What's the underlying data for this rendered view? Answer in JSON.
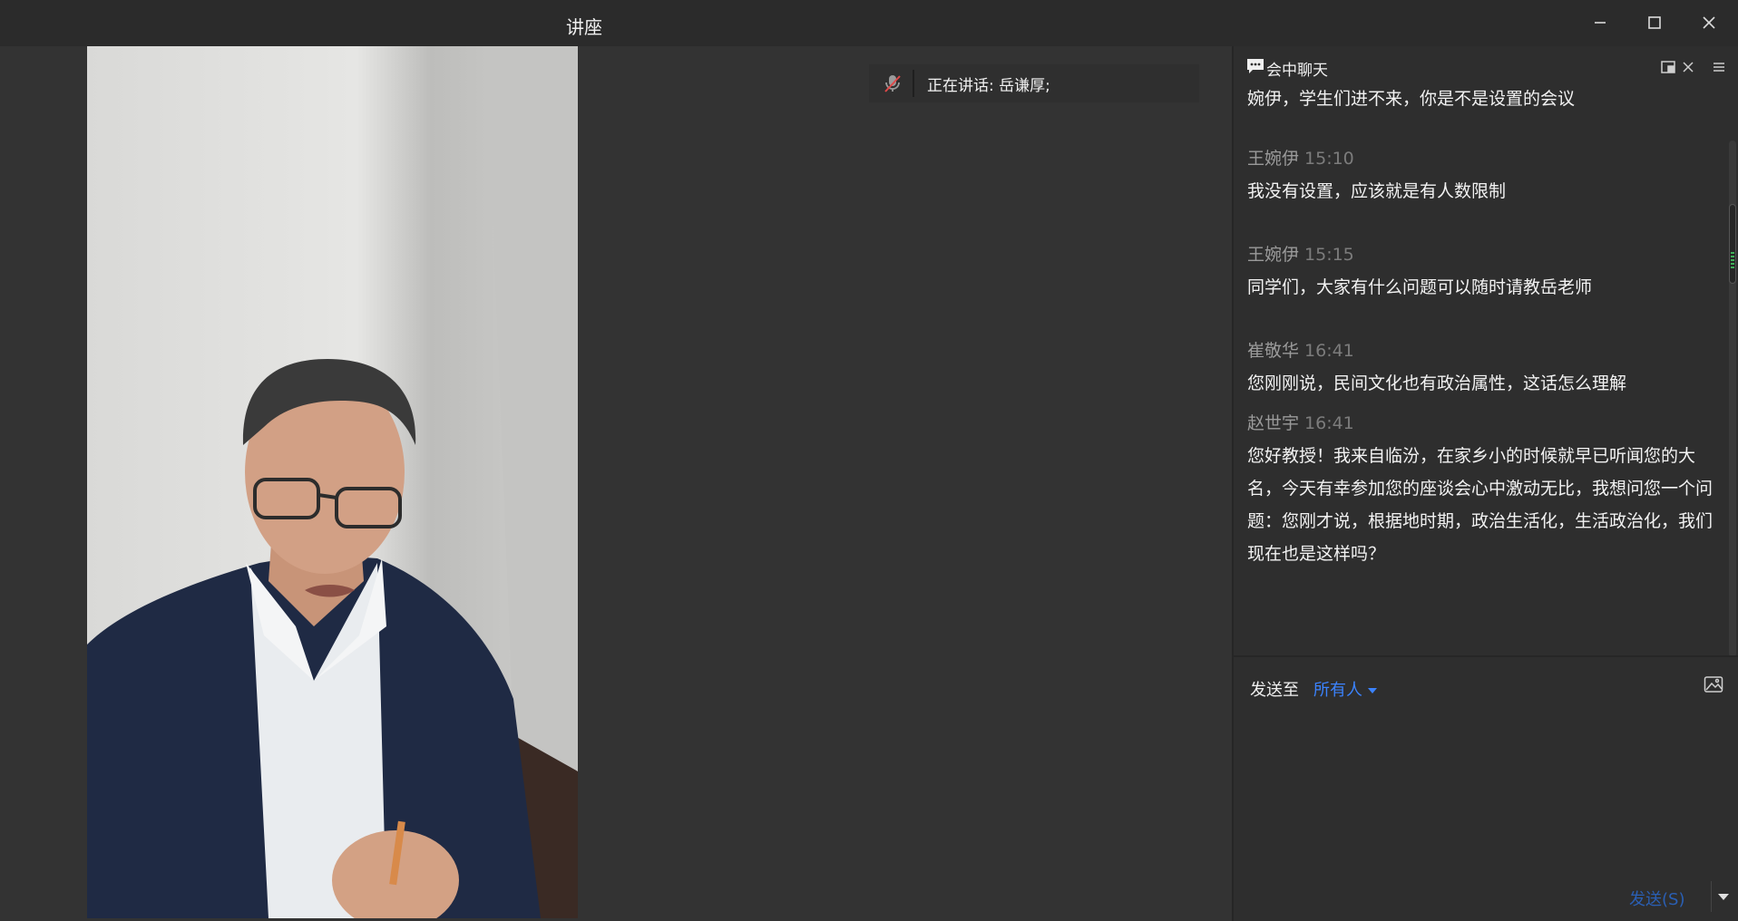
{
  "window": {
    "title": "讲座"
  },
  "speaking": {
    "label": "正在讲话: 岳谦厚;"
  },
  "chat": {
    "title": "会中聊天",
    "messages": [
      {
        "sender": "",
        "time": "",
        "text": "婉伊，学生们进不来，你是不是设置的会议"
      },
      {
        "sender": "王婉伊",
        "time": "15:10",
        "text": "我没有设置，应该就是有人数限制"
      },
      {
        "sender": "王婉伊",
        "time": "15:15",
        "text": "同学们，大家有什么问题可以随时请教岳老师"
      },
      {
        "sender": "崔敬华",
        "time": "16:41",
        "text": "您刚刚说，民间文化也有政治属性，这话怎么理解"
      },
      {
        "sender": "赵世宇",
        "time": "16:41",
        "text": "您好教授！我来自临汾，在家乡小的时候就早已听闻您的大名，今天有幸参加您的座谈会心中激动无比，我想问您一个问题：您刚才说，根据地时期，政治生活化，生活政治化，我们现在也是这样吗？"
      }
    ],
    "send_to_label": "发送至",
    "recipient": "所有人",
    "send_button": "发送(S)"
  },
  "colors": {
    "accent": "#3b83ff",
    "background": "#2e2e2e",
    "stage": "#333333"
  },
  "icons": [
    "minimize-icon",
    "maximize-icon",
    "close-icon",
    "mic-muted-icon",
    "chat-bubble-icon",
    "popout-icon",
    "menu-icon",
    "image-icon"
  ]
}
